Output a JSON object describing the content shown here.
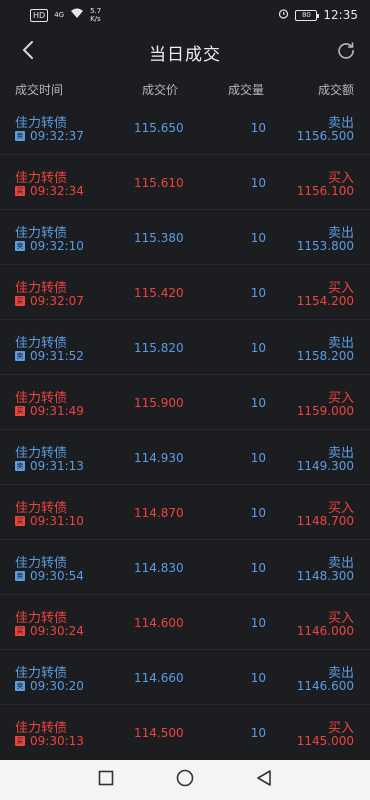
{
  "status_bar": {
    "hd": "HD",
    "signal": "4G",
    "speed_value": "5.7",
    "speed_unit": "K/s",
    "battery": "80",
    "time": "12:35"
  },
  "header": {
    "title": "当日成交",
    "back_icon": "chevron-left-icon",
    "refresh_icon": "refresh-icon"
  },
  "columns": {
    "time": "成交时间",
    "price": "成交价",
    "volume": "成交量",
    "amount": "成交额"
  },
  "side_icons": {
    "sell": "卖",
    "buy": "买"
  },
  "colors": {
    "sell": "#5a9de3",
    "buy": "#f0433c",
    "background": "#1c1d21"
  },
  "trades": [
    {
      "name": "佳力转债",
      "side": "sell",
      "time": "09:32:37",
      "price": "115.650",
      "volume": "10",
      "side_label": "卖出",
      "amount": "1156.500"
    },
    {
      "name": "佳力转债",
      "side": "buy",
      "time": "09:32:34",
      "price": "115.610",
      "volume": "10",
      "side_label": "买入",
      "amount": "1156.100"
    },
    {
      "name": "佳力转债",
      "side": "sell",
      "time": "09:32:10",
      "price": "115.380",
      "volume": "10",
      "side_label": "卖出",
      "amount": "1153.800"
    },
    {
      "name": "佳力转债",
      "side": "buy",
      "time": "09:32:07",
      "price": "115.420",
      "volume": "10",
      "side_label": "买入",
      "amount": "1154.200"
    },
    {
      "name": "佳力转债",
      "side": "sell",
      "time": "09:31:52",
      "price": "115.820",
      "volume": "10",
      "side_label": "卖出",
      "amount": "1158.200"
    },
    {
      "name": "佳力转债",
      "side": "buy",
      "time": "09:31:49",
      "price": "115.900",
      "volume": "10",
      "side_label": "买入",
      "amount": "1159.000"
    },
    {
      "name": "佳力转债",
      "side": "sell",
      "time": "09:31:13",
      "price": "114.930",
      "volume": "10",
      "side_label": "卖出",
      "amount": "1149.300"
    },
    {
      "name": "佳力转债",
      "side": "buy",
      "time": "09:31:10",
      "price": "114.870",
      "volume": "10",
      "side_label": "买入",
      "amount": "1148.700"
    },
    {
      "name": "佳力转债",
      "side": "sell",
      "time": "09:30:54",
      "price": "114.830",
      "volume": "10",
      "side_label": "卖出",
      "amount": "1148.300"
    },
    {
      "name": "佳力转债",
      "side": "buy",
      "time": "09:30:24",
      "price": "114.600",
      "volume": "10",
      "side_label": "买入",
      "amount": "1146.000"
    },
    {
      "name": "佳力转债",
      "side": "sell",
      "time": "09:30:20",
      "price": "114.660",
      "volume": "10",
      "side_label": "卖出",
      "amount": "1146.600"
    },
    {
      "name": "佳力转债",
      "side": "buy",
      "time": "09:30:13",
      "price": "114.500",
      "volume": "10",
      "side_label": "买入",
      "amount": "1145.000"
    }
  ],
  "nav_bar": {
    "recent_icon": "square-icon",
    "home_icon": "circle-icon",
    "back_icon": "triangle-back-icon"
  }
}
